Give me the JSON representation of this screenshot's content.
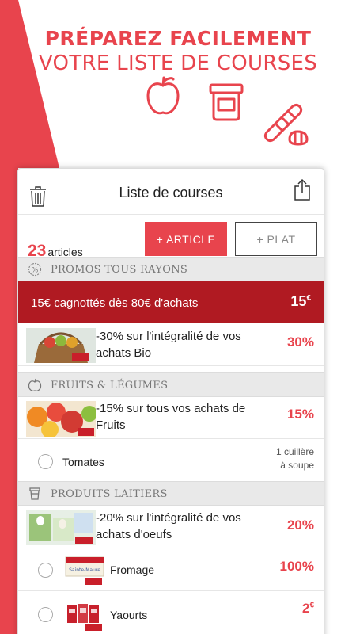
{
  "headline": {
    "line1": "PRÉPAREZ FACILEMENT",
    "line2": "VOTRE LISTE DE COURSES"
  },
  "colors": {
    "accent": "#e8444d",
    "promo_dark": "#b01a22",
    "section_bg": "#e9e9e9"
  },
  "deco_icons": [
    "chicken-leg-icon",
    "apple-icon",
    "jar-icon",
    "bread-icon"
  ],
  "app": {
    "title": "Liste de courses",
    "count": "23",
    "count_label": "articles",
    "add_article": "+ ARTICLE",
    "add_plat": "+ PLAT"
  },
  "sections": {
    "promos": "PROMOS TOUS RAYONS",
    "fruits": "FRUITS & LÉGUMES",
    "laitiers": "PRODUITS LAITIERS"
  },
  "promo_banner": {
    "text": "15€ cagnottés dès 80€ d'achats",
    "value": "15",
    "unit": "€"
  },
  "promo_bio": {
    "line1": "-30% sur l'intégralité de vos",
    "line2": "achats Bio",
    "value": "30%"
  },
  "promo_fruits": {
    "line1": "-15% sur tous vos achats de",
    "line2": "Fruits",
    "value": "15%"
  },
  "tomates": {
    "name": "Tomates",
    "qty_line1": "1 cuillère",
    "qty_line2": "à soupe"
  },
  "promo_oeufs": {
    "line1": "-20% sur l'intégralité de vos",
    "line2": "achats d'oeufs",
    "value": "20%"
  },
  "fromage": {
    "name": "Fromage",
    "value": "100%",
    "brand": "Sainte-Maure"
  },
  "yaourts": {
    "name": "Yaourts",
    "value": "2",
    "unit": "€"
  }
}
